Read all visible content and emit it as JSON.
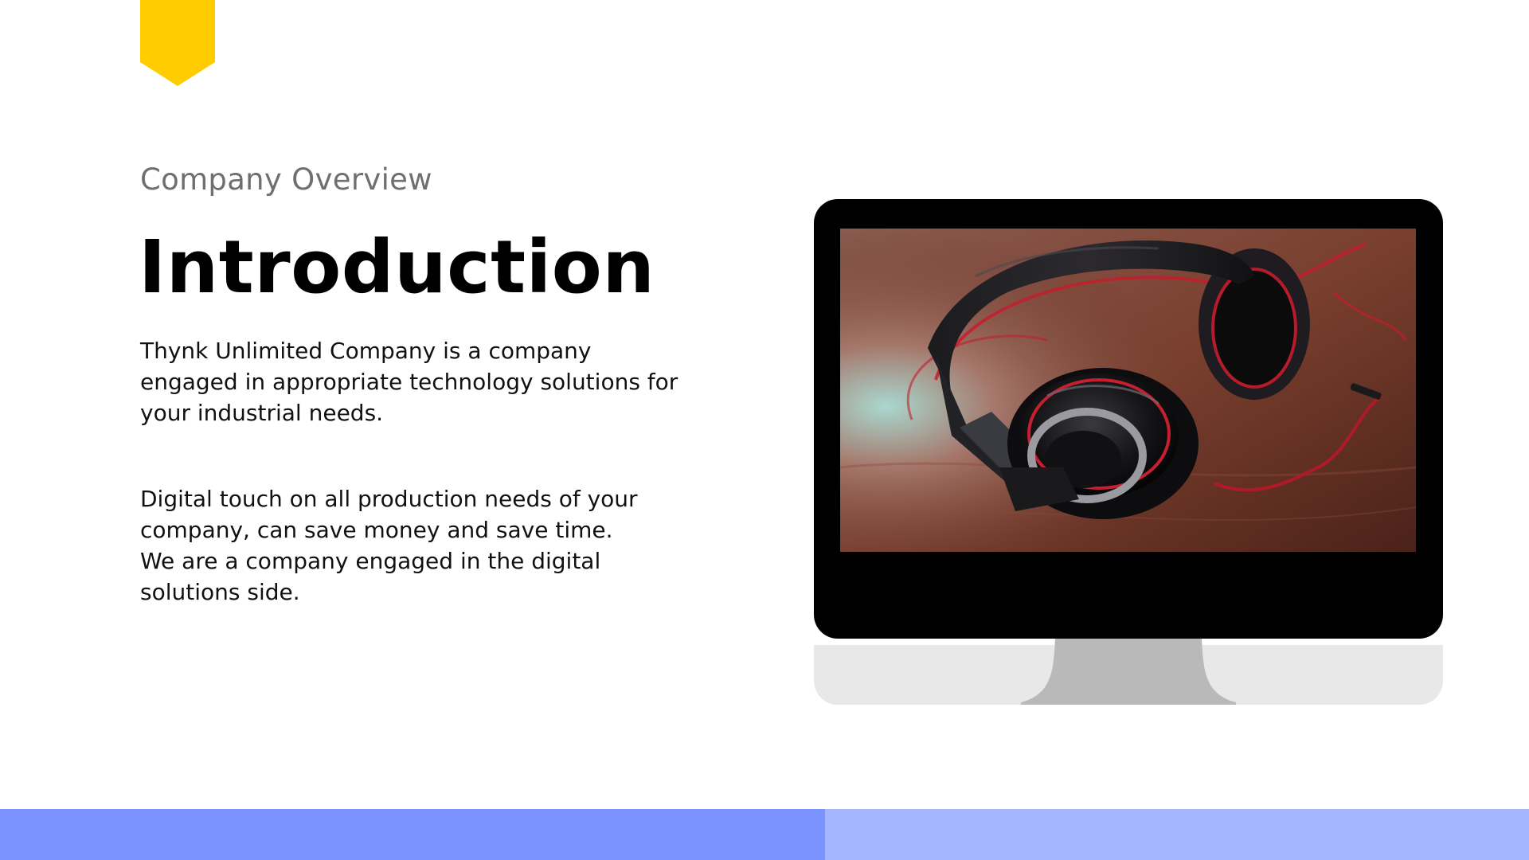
{
  "slide": {
    "kicker": "Company Overview",
    "title": "Introduction",
    "paragraph_1": [
      "Thynk Unlimited Company is a company",
      "engaged in appropriate technology solutions for",
      "your industrial needs."
    ],
    "paragraph_2": [
      "Digital touch on all production needs of your",
      "company, can save money and save time.",
      "We are a company engaged in the digital",
      "solutions side."
    ]
  },
  "decor": {
    "bookmark_icon": "bookmark-ribbon-icon",
    "monitor_icon": "desktop-monitor-icon",
    "screen_image": "headphones-photo"
  },
  "colors": {
    "accent_yellow": "#FFCC00",
    "footer_left": "#7B93FF",
    "footer_right": "#A6B5FF",
    "kicker_gray": "#6F6F6F",
    "monitor_bezel": "#000000",
    "monitor_chin": "#E8E8E8",
    "monitor_stand": "#B9B9B9"
  }
}
